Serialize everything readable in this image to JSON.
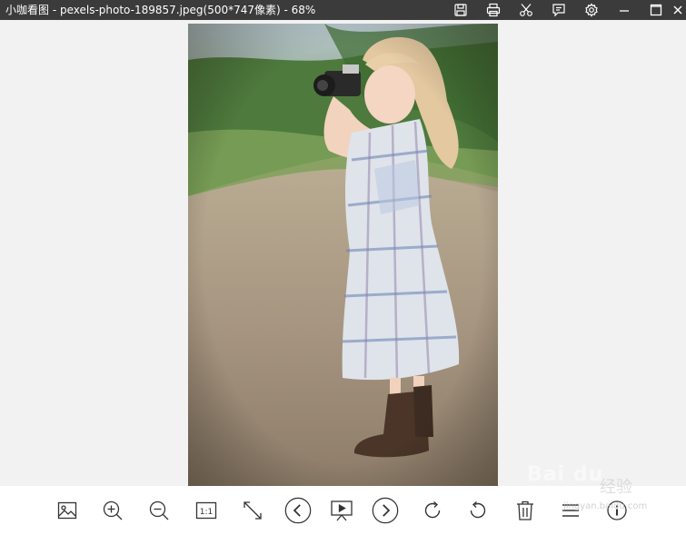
{
  "window": {
    "title": "小咖看图 - pexels-photo-189857.jpeg(500*747像素) - 68%"
  },
  "titlebar_icons": [
    "save-icon",
    "print-icon",
    "cut-icon",
    "feedback-icon",
    "settings-icon",
    "minimize-icon",
    "maximize-icon",
    "close-icon"
  ],
  "toolbar_icons": [
    "image-icon",
    "zoom-in-icon",
    "zoom-out-icon",
    "actual-size-icon",
    "fullscreen-icon",
    "previous-icon",
    "slideshow-icon",
    "next-icon",
    "rotate-right-icon",
    "rotate-left-icon",
    "delete-icon",
    "menu-icon",
    "info-icon"
  ],
  "toolbar": {
    "actual_size_label": "1:1"
  },
  "watermark": {
    "text": "Bai du",
    "cn": "经验",
    "sub": "jingyan.baidu.com"
  },
  "colors": {
    "titlebar": "#3b3b3b",
    "viewer_bg": "#f2f2f2",
    "toolbar_bg": "#ffffff",
    "icon": "#333333"
  }
}
